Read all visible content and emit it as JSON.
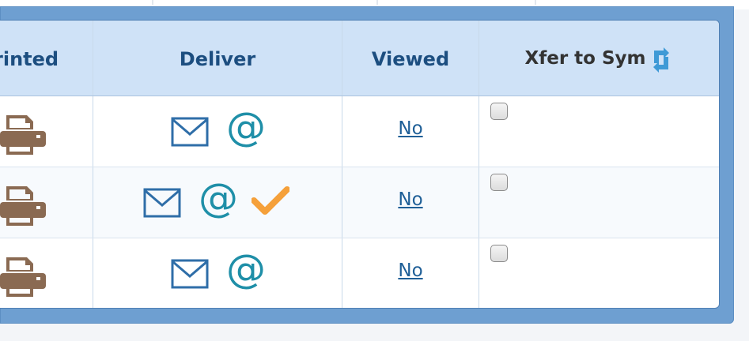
{
  "colors": {
    "header_bg": "#cfe2f7",
    "header_text": "#1c4e80",
    "frame": "#6e9fd1",
    "printer": "#8a6a52",
    "mail": "#2f6ea8",
    "at": "#1f8fa8",
    "check": "#f5a03a",
    "link": "#1f5f97"
  },
  "table": {
    "headers": {
      "printed": "rinted",
      "deliver": "Deliver",
      "viewed": "Viewed",
      "xfer": "Xfer to Sym"
    },
    "header_icons": {
      "xfer": "sync-icon"
    },
    "rows": [
      {
        "printed_icon": "printer-icon",
        "deliver_icons": [
          "mail-icon",
          "at-icon"
        ],
        "viewed": "No",
        "xfer_checked": false
      },
      {
        "printed_icon": "printer-icon",
        "deliver_icons": [
          "mail-icon",
          "at-icon",
          "checkmark-icon"
        ],
        "viewed": "No",
        "xfer_checked": false
      },
      {
        "printed_icon": "printer-icon",
        "deliver_icons": [
          "mail-icon",
          "at-icon"
        ],
        "viewed": "No",
        "xfer_checked": false
      }
    ],
    "at_symbol": "@"
  }
}
